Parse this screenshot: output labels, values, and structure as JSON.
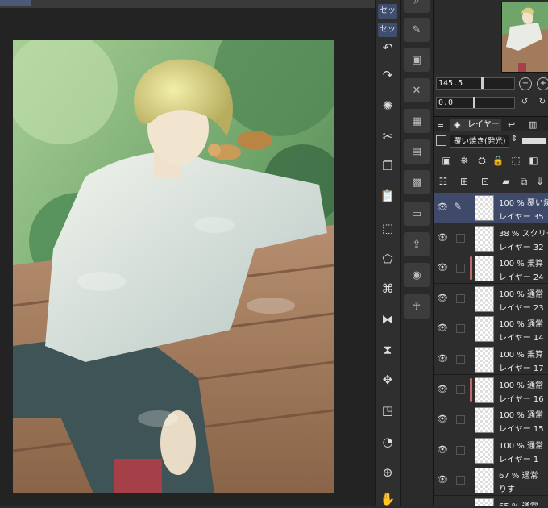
{
  "top_tabs": [
    "",
    ""
  ],
  "tool_tabs": [
    "セッ",
    "セッ"
  ],
  "navigator": {
    "zoom": "145.5",
    "angle": "0.0"
  },
  "layer_panel": {
    "tab_label": "レイヤー",
    "blend_mode": "覆い焼き(発光)",
    "layers": [
      {
        "mode": "100 % 覆い焼",
        "name": "レイヤー 35",
        "selected": true,
        "pen": true,
        "mark": false
      },
      {
        "mode": "38 % スクリー",
        "name": "レイヤー 32",
        "selected": false,
        "pen": false,
        "mark": false
      },
      {
        "mode": "100 % 乗算",
        "name": "レイヤー 24",
        "selected": false,
        "pen": false,
        "mark": true
      },
      {
        "mode": "100 % 通常",
        "name": "レイヤー 23",
        "selected": false,
        "pen": false,
        "mark": false
      },
      {
        "mode": "100 % 通常",
        "name": "レイヤー 14",
        "selected": false,
        "pen": false,
        "mark": false
      },
      {
        "mode": "100 % 乗算",
        "name": "レイヤー 17",
        "selected": false,
        "pen": false,
        "mark": false
      },
      {
        "mode": "100 % 通常",
        "name": "レイヤー 16",
        "selected": false,
        "pen": false,
        "mark": true
      },
      {
        "mode": "100 % 通常",
        "name": "レイヤー 15",
        "selected": false,
        "pen": false,
        "mark": false
      },
      {
        "mode": "100 % 通常",
        "name": "レイヤー 1",
        "selected": false,
        "pen": false,
        "mark": false
      },
      {
        "mode": "67 % 通常",
        "name": "りす",
        "selected": false,
        "pen": false,
        "mark": false
      },
      {
        "mode": "65 % 通常",
        "name": "",
        "selected": false,
        "pen": false,
        "mark": false
      }
    ]
  },
  "colors": {
    "accent": "#3f4a6b",
    "layer_mark": "#c56a6a",
    "nav_line": "#b03030"
  }
}
